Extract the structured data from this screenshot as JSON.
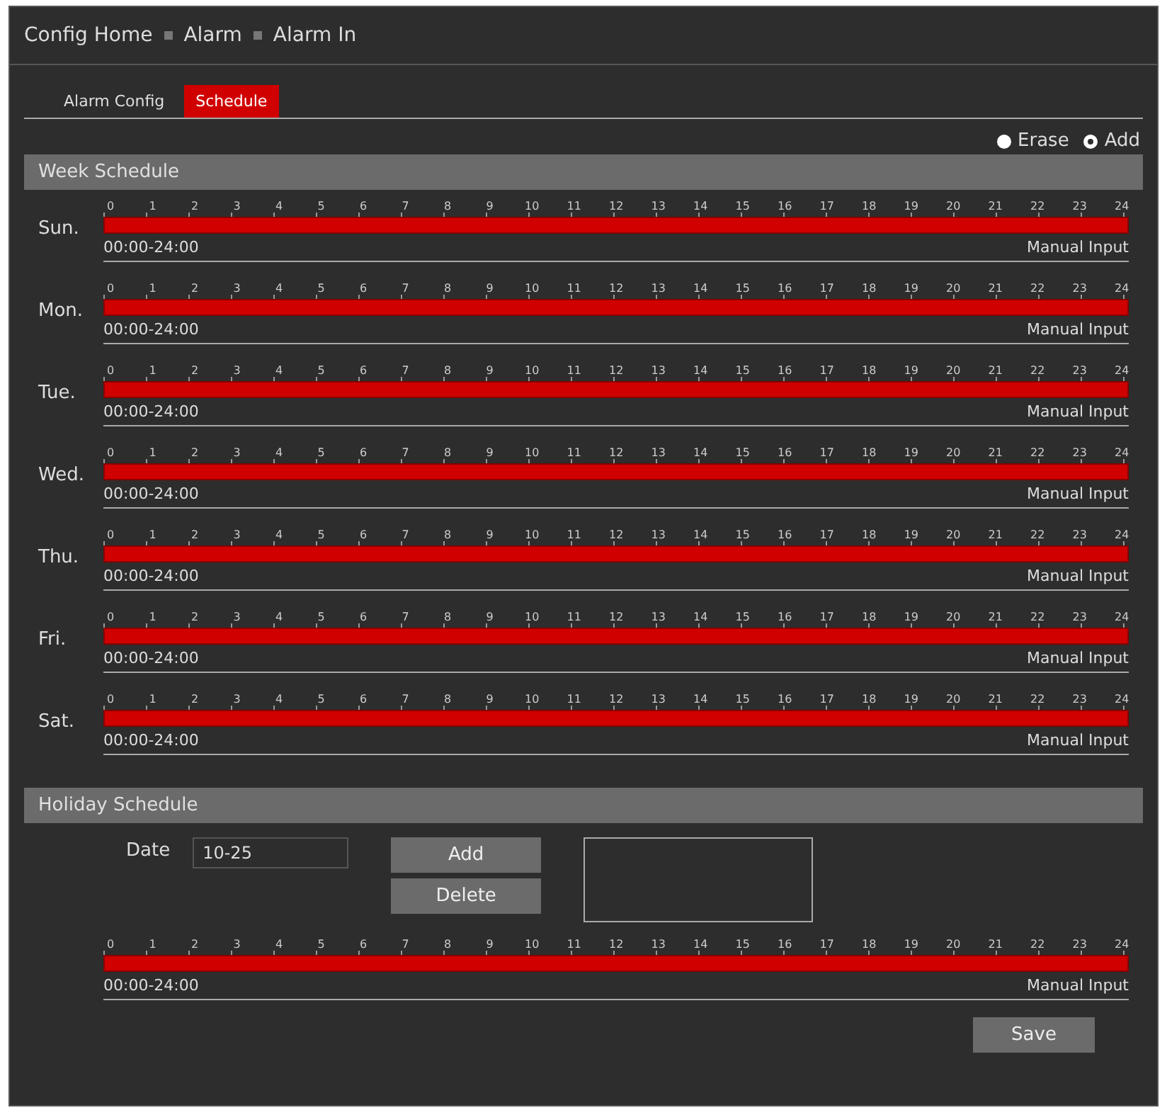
{
  "breadcrumb": [
    "Config Home",
    "Alarm",
    "Alarm In"
  ],
  "tabs": [
    {
      "label": "Alarm Config",
      "selected": false
    },
    {
      "label": "Schedule",
      "selected": true
    }
  ],
  "mode_options": [
    {
      "label": "Erase",
      "selected": false
    },
    {
      "label": "Add",
      "selected": true
    }
  ],
  "week_schedule": {
    "title": "Week Schedule",
    "days": [
      {
        "day": "Sun.",
        "hours": [
          "0",
          "1",
          "2",
          "3",
          "4",
          "5",
          "6",
          "7",
          "8",
          "9",
          "10",
          "11",
          "12",
          "13",
          "14",
          "15",
          "16",
          "17",
          "18",
          "19",
          "20",
          "21",
          "22",
          "23",
          "24"
        ],
        "level": 1,
        "range": "00:00-24:00",
        "action": "Manual Input"
      },
      {
        "day": "Mon.",
        "hours": [
          "0",
          "1",
          "2",
          "3",
          "4",
          "5",
          "6",
          "7",
          "8",
          "9",
          "10",
          "11",
          "12",
          "13",
          "14",
          "15",
          "16",
          "17",
          "18",
          "19",
          "20",
          "21",
          "22",
          "23",
          "24"
        ],
        "level": 1,
        "range": "00:00-24:00",
        "action": "Manual Input"
      },
      {
        "day": "Tue.",
        "hours": [
          "0",
          "1",
          "2",
          "3",
          "4",
          "5",
          "6",
          "7",
          "8",
          "9",
          "10",
          "11",
          "12",
          "13",
          "14",
          "15",
          "16",
          "17",
          "18",
          "19",
          "20",
          "21",
          "22",
          "23",
          "24"
        ],
        "level": 1,
        "range": "00:00-24:00",
        "action": "Manual Input"
      },
      {
        "day": "Wed.",
        "hours": [
          "0",
          "1",
          "2",
          "3",
          "4",
          "5",
          "6",
          "7",
          "8",
          "9",
          "10",
          "11",
          "12",
          "13",
          "14",
          "15",
          "16",
          "17",
          "18",
          "19",
          "20",
          "21",
          "22",
          "23",
          "24"
        ],
        "level": 1,
        "range": "00:00-24:00",
        "action": "Manual Input"
      },
      {
        "day": "Thu.",
        "hours": [
          "0",
          "1",
          "2",
          "3",
          "4",
          "5",
          "6",
          "7",
          "8",
          "9",
          "10",
          "11",
          "12",
          "13",
          "14",
          "15",
          "16",
          "17",
          "18",
          "19",
          "20",
          "21",
          "22",
          "23",
          "24"
        ],
        "level": 1,
        "range": "00:00-24:00",
        "action": "Manual Input"
      },
      {
        "day": "Fri.",
        "hours": [
          "0",
          "1",
          "2",
          "3",
          "4",
          "5",
          "6",
          "7",
          "8",
          "9",
          "10",
          "11",
          "12",
          "13",
          "14",
          "15",
          "16",
          "17",
          "18",
          "19",
          "20",
          "21",
          "22",
          "23",
          "24"
        ],
        "level": 1,
        "range": "00:00-24:00",
        "action": "Manual Input"
      },
      {
        "day": "Sat.",
        "hours": [
          "0",
          "1",
          "2",
          "3",
          "4",
          "5",
          "6",
          "7",
          "8",
          "9",
          "10",
          "11",
          "12",
          "13",
          "14",
          "15",
          "16",
          "17",
          "18",
          "19",
          "20",
          "21",
          "22",
          "23",
          "24"
        ],
        "level": 1,
        "range": "00:00-24:00",
        "action": "Manual Input"
      }
    ]
  },
  "holiday_schedule": {
    "title": "Holiday Schedule",
    "date_label": "Date",
    "date_value": "10-25",
    "buttons": [
      "Add",
      "Delete"
    ],
    "timeline": {
      "hours": [
        "0",
        "1",
        "2",
        "3",
        "4",
        "5",
        "6",
        "7",
        "8",
        "9",
        "10",
        "11",
        "12",
        "13",
        "14",
        "15",
        "16",
        "17",
        "18",
        "19",
        "20",
        "21",
        "22",
        "23",
        "24"
      ],
      "level": 1,
      "range": "00:00-24:00",
      "action": "Manual Input"
    }
  },
  "save_button": "Save"
}
